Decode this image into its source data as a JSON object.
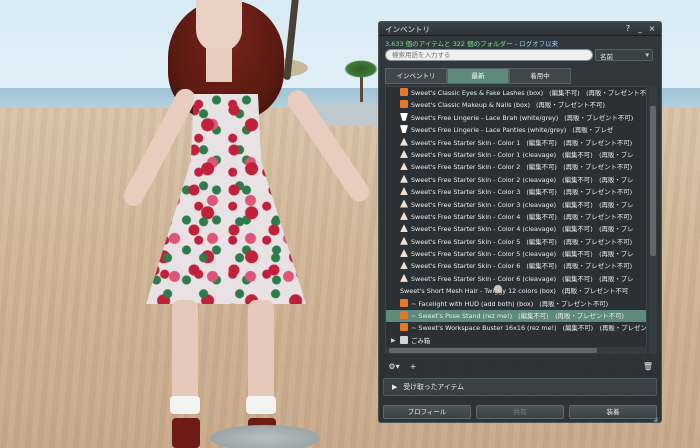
{
  "window": {
    "title": "インベントリ",
    "help_label": "?",
    "minimize_label": "_",
    "close_label": "×",
    "summary_items": "3,633 個のアイテムと 322 個のフォルダー",
    "summary_link": "- ログオフ以来",
    "search_placeholder": "検索用語を入力する",
    "sort_value": "名前"
  },
  "tabs": [
    {
      "label": "インベントリ",
      "active": false
    },
    {
      "label": "最新",
      "active": true
    },
    {
      "label": "着用中",
      "active": false
    }
  ],
  "items": [
    {
      "icon": "box-icon",
      "name": "Sweet's Classic Eyes & Fake Lashes (box)",
      "meta": "(編集不可)　(再販・プレゼント不可)",
      "selected": false
    },
    {
      "icon": "box-icon",
      "name": "Sweet's Classic Makeup & Nails (box)",
      "meta": "(再販・プレゼント不可)",
      "selected": false
    },
    {
      "icon": "clothing-icon",
      "name": "Sweet's Free Lingerie - Lace Brah (white/grey)",
      "meta": "(再販・プレゼント不可)",
      "selected": false
    },
    {
      "icon": "clothing-icon",
      "name": "Sweet's Free Lingerie - Lace Panties (white/grey)",
      "meta": "(再販・プレゼ",
      "selected": false
    },
    {
      "icon": "bodypart-icon",
      "name": "Sweet's Free Starter Skin - Color 1",
      "meta": "(編集不可)　(再販・プレゼント不可)",
      "selected": false
    },
    {
      "icon": "bodypart-icon",
      "name": "Sweet's Free Starter Skin - Color 1 (cleavage)",
      "meta": "(編集不可)　(再販・プレ",
      "selected": false
    },
    {
      "icon": "bodypart-icon",
      "name": "Sweet's Free Starter Skin - Color 2",
      "meta": "(編集不可)　(再販・プレゼント不可)",
      "selected": false
    },
    {
      "icon": "bodypart-icon",
      "name": "Sweet's Free Starter Skin - Color 2 (cleavage)",
      "meta": "(編集不可)　(再販・プレ",
      "selected": false
    },
    {
      "icon": "bodypart-icon",
      "name": "Sweet's Free Starter Skin - Color 3",
      "meta": "(編集不可)　(再販・プレゼント不可)",
      "selected": false
    },
    {
      "icon": "bodypart-icon",
      "name": "Sweet's Free Starter Skin - Color 3 (cleavage)",
      "meta": "(編集不可)　(再販・プレ",
      "selected": false
    },
    {
      "icon": "bodypart-icon",
      "name": "Sweet's Free Starter Skin - Color 4",
      "meta": "(編集不可)　(再販・プレゼント不可)",
      "selected": false
    },
    {
      "icon": "bodypart-icon",
      "name": "Sweet's Free Starter Skin - Color 4 (cleavage)",
      "meta": "(編集不可)　(再販・プレ",
      "selected": false
    },
    {
      "icon": "bodypart-icon",
      "name": "Sweet's Free Starter Skin - Color 5",
      "meta": "(編集不可)　(再販・プレゼント不可)",
      "selected": false
    },
    {
      "icon": "bodypart-icon",
      "name": "Sweet's Free Starter Skin - Color 5 (cleavage)",
      "meta": "(編集不可)　(再販・プレ",
      "selected": false
    },
    {
      "icon": "bodypart-icon",
      "name": "Sweet's Free Starter Skin - Color 6",
      "meta": "(編集不可)　(再販・プレゼント不可)",
      "selected": false
    },
    {
      "icon": "bodypart-icon",
      "name": "Sweet's Free Starter Skin - Color 6 (cleavage)",
      "meta": "(編集不可)　(再販・プレ",
      "selected": false
    },
    {
      "icon": "hair-icon",
      "name": "Sweet's Short Mesh Hair - Twiggy 12 colors (box)",
      "meta": "(再販・プレゼント不可",
      "selected": false
    },
    {
      "icon": "box-icon",
      "name": "~ Facelight with HUD (add both) (box)",
      "meta": "(再販・プレゼント不可)",
      "selected": false
    },
    {
      "icon": "box-icon",
      "name": "~ Sweet's Pose Stand (rez me!)",
      "meta": "(編集不可)　(再販・プレゼント不可)",
      "selected": true
    },
    {
      "icon": "box-icon",
      "name": "~ Sweet's Workspace Buster 16x16 (rez me!)",
      "meta": "(編集不可)　(再販・プレゼント不可)",
      "selected": false
    },
    {
      "icon": "trash-icon",
      "name": "ごみ箱",
      "meta": "",
      "selected": false,
      "folder": true
    }
  ],
  "toolbar": {
    "gear_label": "⚙▾",
    "add_label": "+",
    "trash_label": "🗑"
  },
  "received_label": "受け取ったアイテム",
  "buttons": {
    "profile": "プロフィール",
    "share": "共有",
    "wear": "装着"
  }
}
